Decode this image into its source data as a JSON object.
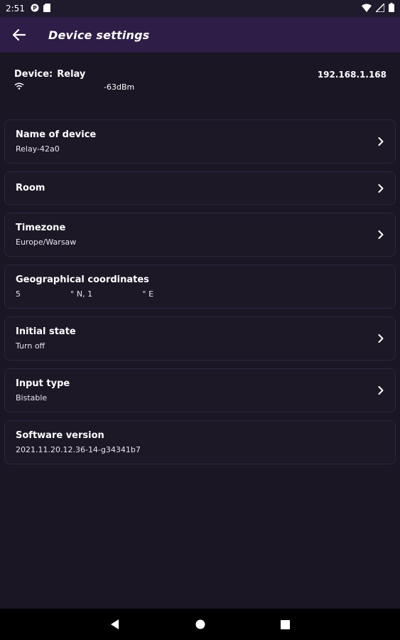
{
  "status_bar": {
    "time": "2:51"
  },
  "app_bar": {
    "title": "Device settings"
  },
  "device": {
    "label": "Device:",
    "name": "Relay",
    "ip": "192.168.1.168",
    "signal": "-63dBm"
  },
  "settings": [
    {
      "title": "Name of device",
      "value": "Relay-42a0"
    },
    {
      "title": "Room",
      "value": ""
    },
    {
      "title": "Timezone",
      "value": "Europe/Warsaw"
    },
    {
      "title": "Geographical coordinates",
      "value": "5                    ° N, 1                    ° E"
    },
    {
      "title": "Initial state",
      "value": "Turn off"
    },
    {
      "title": "Input type",
      "value": "Bistable"
    },
    {
      "title": "Software version",
      "value": "2021.11.20.12.36-14-g34341b7"
    }
  ],
  "colors": {
    "background": "#1a1624",
    "app_bar": "#2d1d47",
    "card": "#1c1826",
    "card_border": "#2e2740"
  }
}
